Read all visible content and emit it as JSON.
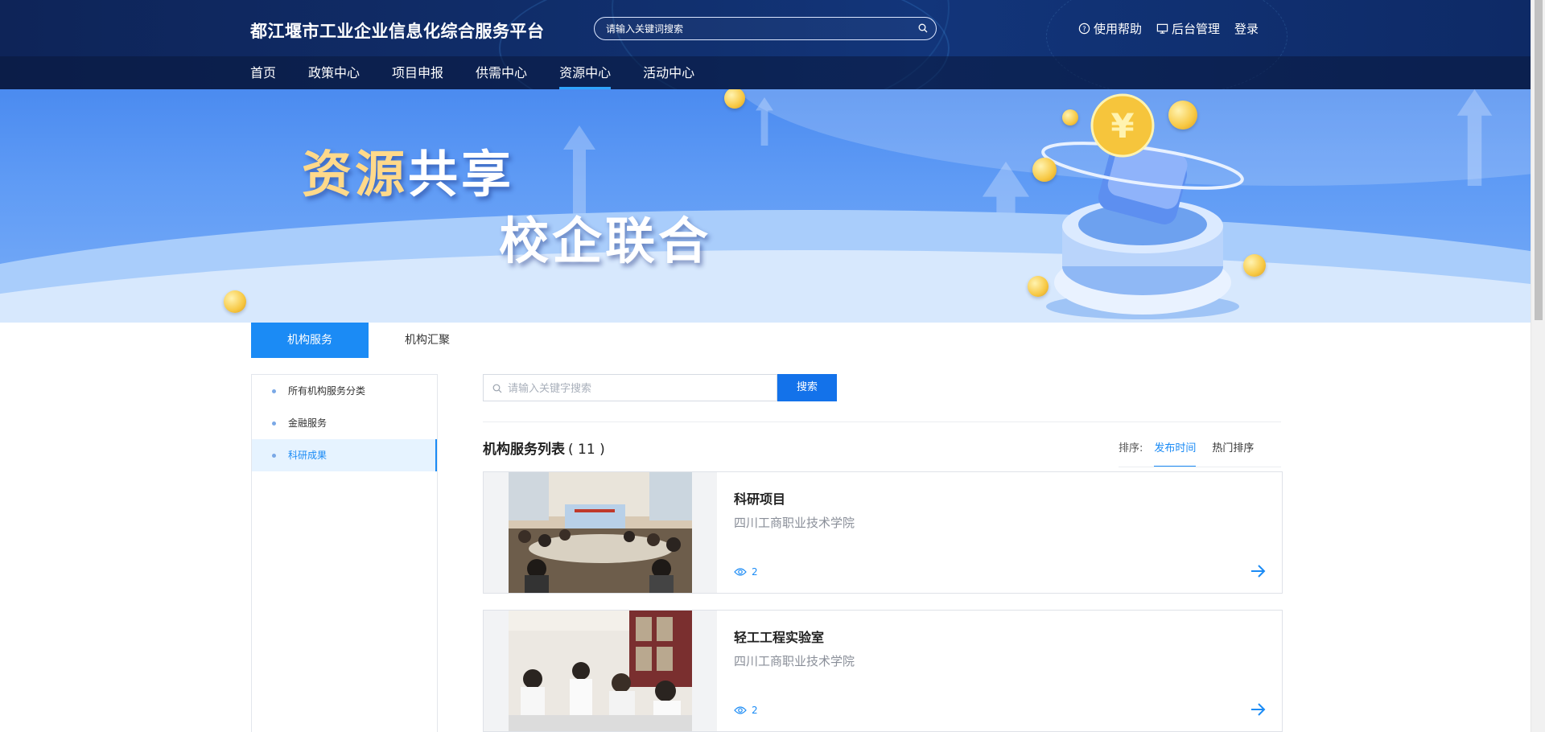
{
  "header": {
    "site_title": "都江堰市工业企业信息化综合服务平台",
    "search_placeholder": "请输入关键词搜索",
    "links": [
      {
        "label": "使用帮助",
        "icon": "help-circle-icon"
      },
      {
        "label": "后台管理",
        "icon": "monitor-icon"
      },
      {
        "label": "登录",
        "icon": ""
      }
    ]
  },
  "nav": {
    "items": [
      "首页",
      "政策中心",
      "项目申报",
      "供需中心",
      "资源中心",
      "活动中心"
    ],
    "active": "资源中心"
  },
  "banner": {
    "line1_a": "资源",
    "line1_b": "共享",
    "line2": "校企联合"
  },
  "tabs": {
    "items": [
      "机构服务",
      "机构汇聚"
    ],
    "active": "机构服务"
  },
  "sidebar": {
    "items": [
      "所有机构服务分类",
      "金融服务",
      "科研成果"
    ],
    "active": "科研成果"
  },
  "search": {
    "placeholder": "请输入关键字搜索",
    "button": "搜索"
  },
  "list": {
    "title": "机构服务列表",
    "count": "( 11 )",
    "sort_label": "排序:",
    "sort_options": [
      "发布时间",
      "热门排序"
    ],
    "sort_active": "发布时间",
    "items": [
      {
        "name": "科研项目",
        "org": "四川工商职业技术学院",
        "views": "2"
      },
      {
        "name": "轻工工程实验室",
        "org": "四川工商职业技术学院",
        "views": "2"
      }
    ]
  },
  "colors": {
    "primary": "#1b8bf5",
    "header_bg": "#0e2458",
    "search_button": "#1372ea"
  }
}
